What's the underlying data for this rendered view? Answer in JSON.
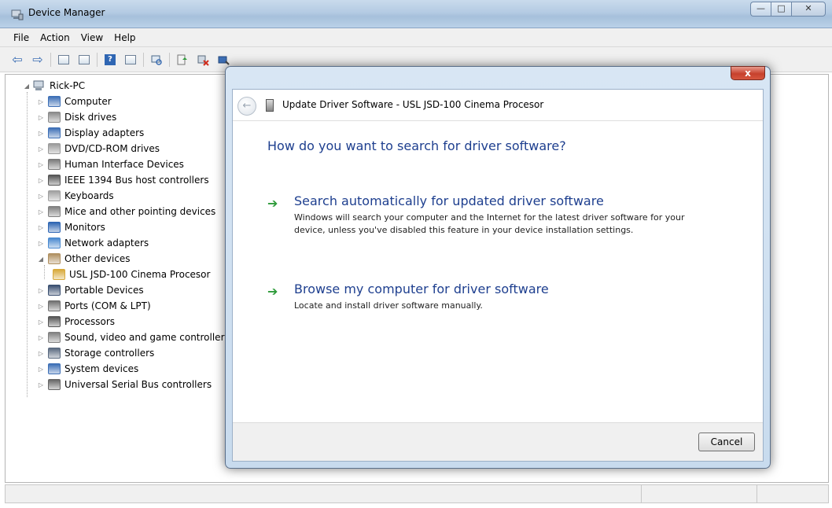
{
  "window": {
    "title": "Device Manager",
    "minimize_glyph": "—",
    "maximize_glyph": "□",
    "close_glyph": "✕"
  },
  "menu": [
    "File",
    "Action",
    "View",
    "Help"
  ],
  "tree": {
    "root": "Rick-PC",
    "items": [
      {
        "label": "Computer",
        "expanded": false,
        "color": "#3d6fb6"
      },
      {
        "label": "Disk drives",
        "expanded": false,
        "color": "#8a8a8a"
      },
      {
        "label": "Display adapters",
        "expanded": false,
        "color": "#3d6fb6"
      },
      {
        "label": "DVD/CD-ROM drives",
        "expanded": false,
        "color": "#9a9a9a"
      },
      {
        "label": "Human Interface Devices",
        "expanded": false,
        "color": "#7a7a7a"
      },
      {
        "label": "IEEE 1394 Bus host controllers",
        "expanded": false,
        "color": "#555555"
      },
      {
        "label": "Keyboards",
        "expanded": false,
        "color": "#a0a0a0"
      },
      {
        "label": "Mice and other pointing devices",
        "expanded": false,
        "color": "#808080"
      },
      {
        "label": "Monitors",
        "expanded": false,
        "color": "#2f66b3"
      },
      {
        "label": "Network adapters",
        "expanded": false,
        "color": "#4a8ad0"
      },
      {
        "label": "Other devices",
        "expanded": true,
        "color": "#b09060"
      },
      {
        "label": "USL JSD-100 Cinema Procesor",
        "child": true,
        "color": "#d8a93a"
      },
      {
        "label": "Portable Devices",
        "expanded": false,
        "color": "#3a4f70"
      },
      {
        "label": "Ports (COM & LPT)",
        "expanded": false,
        "color": "#707070"
      },
      {
        "label": "Processors",
        "expanded": false,
        "color": "#555555"
      },
      {
        "label": "Sound, video and game controllers",
        "expanded": false,
        "color": "#808080"
      },
      {
        "label": "Storage controllers",
        "expanded": false,
        "color": "#5a6a80"
      },
      {
        "label": "System devices",
        "expanded": false,
        "color": "#3d6fb6"
      },
      {
        "label": "Universal Serial Bus controllers",
        "expanded": false,
        "color": "#666666"
      }
    ]
  },
  "dialog": {
    "close_label": "x",
    "back_glyph": "←",
    "title": "Update Driver Software - USL JSD-100 Cinema Procesor",
    "question": "How do you want to search for driver software?",
    "options": [
      {
        "arrow": "➔",
        "title": "Search automatically for updated driver software",
        "description": "Windows will search your computer and the Internet for the latest driver software for your device, unless you've disabled this feature in your device installation settings."
      },
      {
        "arrow": "➔",
        "title": "Browse my computer for driver software",
        "description": "Locate and install driver software manually."
      }
    ],
    "cancel_label": "Cancel"
  }
}
